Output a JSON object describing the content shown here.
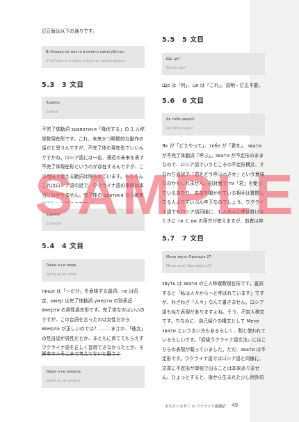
{
  "left": {
    "intro": "訂正版は以下の通りです。",
    "box1": {
      "line1": "Ві більше не маєте вчинити самогубство.",
      "line2": "Vi bil'she ne maiete vchynyty samohubstvo."
    },
    "h53": "5.3　3 文目",
    "box2": {
      "line1": "Здаюсь",
      "line2": "Zdaius'"
    },
    "para53": "不完了体動詞 здаватися「降伏する」の 1 人称単数現在形です。これ、未来かつ瞬間的な動作の話だと思うんですが、不完了体の現在形でいいんですかね。ロシア語には一応、適近の未来を表す不完了体現在形というのが存在するんですが、この用法で使える動詞は限られています。もちろんこれはロシア語の話で、ウクライナ語の事情は本当に分かりません。完了体の здатися なら確実に正しいと思うのですが。",
    "box3": {
      "line1": "Здамся",
      "line2": "Zdamsia"
    },
    "h54": "5.4　4 文目",
    "box4": {
      "line1": "Лише я не вмер.",
      "line2": "Lyshe ja ne vmer."
    },
    "para54": "лише は「～だけ」を意味する副詞、не は否定、вмер は完了体動詞 умерти の別表記 вмерти の男性過去形です。完了体なのはいいのですが、この台詞を言ったのは女性だから вмерла が正しいのでは？ …… まさか、「彼女」の性自認が男性だとか、まともに育ててもらえずウクライナ語を正しく習得できなかったとか、そういう話だったりします？",
    "para54_strike": "脚本の人そこまで考えてないと思うよ",
    "box5": {
      "line1": "Лише я не вмерла.",
      "line2": "Lyshe ja ne vmerla."
    }
  },
  "right": {
    "h55": "5.5　5 文目",
    "box6": {
      "line1": "Що це?",
      "line2": "Shcho tse?"
    },
    "para55": "Що は「何」、це は「これ」。説明・訂正不要。",
    "h56": "5.6　6 文目",
    "box7": {
      "line1": "Як тебе звати?",
      "line2": "Iak tebe zvaty?"
    },
    "para56": "Як が「どうやって」、тебе が「君を」、звати が不完了体動詞「呼ぶ」。звати が不定形のままなので、ロシア語でいうところの不定形構文、すなわち直訳で「君をどう呼ぶべきか」という意味なのかもしれません。初対面で ти「君」を使っているあたり、名前を聞かれている相手は質問してる人よりずいぶん年下なのでしょう。ウクライナ語でもロシア語同様に、1 人の人に呼び掛けるときに ти と ви の両方が使えますが、前者は仲の良い人や子供相手のときに使います。",
    "h57": "5.7　7 文目",
    "box8": {
      "line1": "Мене звуть Operація 27.",
      "line2": "Mene zvut' Operatsiia 27."
    },
    "para57": "звуть は звати の三人称複数現在形です。直訳すると「私は人々から～と呼ばれています」ですが、わざわざ「人々」なんて書きません。ロシア語も似た表現がありますよね。そう、不定人称文です。ちなみに、自己紹介の構文として Мене звати という言い方もあるらしく、割と使われているらしいです。『初級ウクライナ語文法』にはこちらの表現が載っていました。ただ、звати は不定形です。ウクライナ語ではロシア語と同様に、文章に不定形が単独で出ることは本来ありません。ひょっとすると、後から生まれた少し例外的な慣用表現なのかもしれません。"
  },
  "watermark": "SAMPLE",
  "footer": {
    "series": "まちカドまぞく in ウクライナ語翻訳",
    "page": "49"
  }
}
